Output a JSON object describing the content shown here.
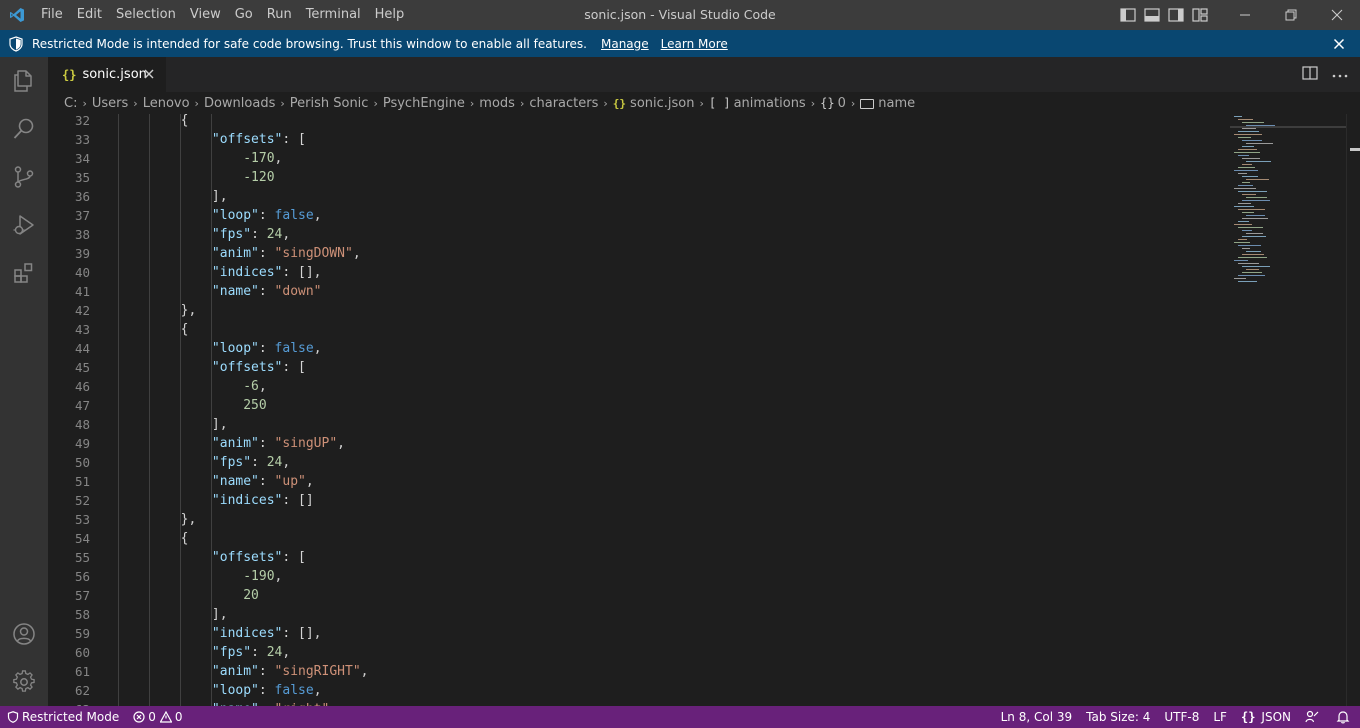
{
  "titlebar": {
    "menu": [
      "File",
      "Edit",
      "Selection",
      "View",
      "Go",
      "Run",
      "Terminal",
      "Help"
    ],
    "window_title": "sonic.json - Visual Studio Code"
  },
  "banner": {
    "text": "Restricted Mode is intended for safe code browsing. Trust this window to enable all features.",
    "manage": "Manage",
    "learn_more": "Learn More"
  },
  "tab": {
    "icon": "{}",
    "label": "sonic.json"
  },
  "breadcrumbs": {
    "path": [
      "C:",
      "Users",
      "Lenovo",
      "Downloads",
      "Perish Sonic",
      "PsychEngine",
      "mods",
      "characters"
    ],
    "file": "sonic.json",
    "file_icon": "{}",
    "symbols": [
      {
        "icon": "[ ]",
        "label": "animations"
      },
      {
        "icon": "{}",
        "label": "0"
      },
      {
        "icon": "abc",
        "label": "name"
      }
    ]
  },
  "editor": {
    "first_line": 32,
    "lines": [
      [
        [
          "pun",
          "        {"
        ]
      ],
      [
        [
          "pun",
          "            "
        ],
        [
          "key",
          "\"offsets\""
        ],
        [
          "pun",
          ": ["
        ]
      ],
      [
        [
          "pun",
          "                "
        ],
        [
          "num",
          "-170"
        ],
        [
          "pun",
          ","
        ]
      ],
      [
        [
          "pun",
          "                "
        ],
        [
          "num",
          "-120"
        ]
      ],
      [
        [
          "pun",
          "            ],"
        ]
      ],
      [
        [
          "pun",
          "            "
        ],
        [
          "key",
          "\"loop\""
        ],
        [
          "pun",
          ": "
        ],
        [
          "kw",
          "false"
        ],
        [
          "pun",
          ","
        ]
      ],
      [
        [
          "pun",
          "            "
        ],
        [
          "key",
          "\"fps\""
        ],
        [
          "pun",
          ": "
        ],
        [
          "num",
          "24"
        ],
        [
          "pun",
          ","
        ]
      ],
      [
        [
          "pun",
          "            "
        ],
        [
          "key",
          "\"anim\""
        ],
        [
          "pun",
          ": "
        ],
        [
          "str",
          "\"singDOWN\""
        ],
        [
          "pun",
          ","
        ]
      ],
      [
        [
          "pun",
          "            "
        ],
        [
          "key",
          "\"indices\""
        ],
        [
          "pun",
          ": [],"
        ]
      ],
      [
        [
          "pun",
          "            "
        ],
        [
          "key",
          "\"name\""
        ],
        [
          "pun",
          ": "
        ],
        [
          "str",
          "\"down\""
        ]
      ],
      [
        [
          "pun",
          "        },"
        ]
      ],
      [
        [
          "pun",
          "        {"
        ]
      ],
      [
        [
          "pun",
          "            "
        ],
        [
          "key",
          "\"loop\""
        ],
        [
          "pun",
          ": "
        ],
        [
          "kw",
          "false"
        ],
        [
          "pun",
          ","
        ]
      ],
      [
        [
          "pun",
          "            "
        ],
        [
          "key",
          "\"offsets\""
        ],
        [
          "pun",
          ": ["
        ]
      ],
      [
        [
          "pun",
          "                "
        ],
        [
          "num",
          "-6"
        ],
        [
          "pun",
          ","
        ]
      ],
      [
        [
          "pun",
          "                "
        ],
        [
          "num",
          "250"
        ]
      ],
      [
        [
          "pun",
          "            ],"
        ]
      ],
      [
        [
          "pun",
          "            "
        ],
        [
          "key",
          "\"anim\""
        ],
        [
          "pun",
          ": "
        ],
        [
          "str",
          "\"singUP\""
        ],
        [
          "pun",
          ","
        ]
      ],
      [
        [
          "pun",
          "            "
        ],
        [
          "key",
          "\"fps\""
        ],
        [
          "pun",
          ": "
        ],
        [
          "num",
          "24"
        ],
        [
          "pun",
          ","
        ]
      ],
      [
        [
          "pun",
          "            "
        ],
        [
          "key",
          "\"name\""
        ],
        [
          "pun",
          ": "
        ],
        [
          "str",
          "\"up\""
        ],
        [
          "pun",
          ","
        ]
      ],
      [
        [
          "pun",
          "            "
        ],
        [
          "key",
          "\"indices\""
        ],
        [
          "pun",
          ": []"
        ]
      ],
      [
        [
          "pun",
          "        },"
        ]
      ],
      [
        [
          "pun",
          "        {"
        ]
      ],
      [
        [
          "pun",
          "            "
        ],
        [
          "key",
          "\"offsets\""
        ],
        [
          "pun",
          ": ["
        ]
      ],
      [
        [
          "pun",
          "                "
        ],
        [
          "num",
          "-190"
        ],
        [
          "pun",
          ","
        ]
      ],
      [
        [
          "pun",
          "                "
        ],
        [
          "num",
          "20"
        ]
      ],
      [
        [
          "pun",
          "            ],"
        ]
      ],
      [
        [
          "pun",
          "            "
        ],
        [
          "key",
          "\"indices\""
        ],
        [
          "pun",
          ": [],"
        ]
      ],
      [
        [
          "pun",
          "            "
        ],
        [
          "key",
          "\"fps\""
        ],
        [
          "pun",
          ": "
        ],
        [
          "num",
          "24"
        ],
        [
          "pun",
          ","
        ]
      ],
      [
        [
          "pun",
          "            "
        ],
        [
          "key",
          "\"anim\""
        ],
        [
          "pun",
          ": "
        ],
        [
          "str",
          "\"singRIGHT\""
        ],
        [
          "pun",
          ","
        ]
      ],
      [
        [
          "pun",
          "            "
        ],
        [
          "key",
          "\"loop\""
        ],
        [
          "pun",
          ": "
        ],
        [
          "kw",
          "false"
        ],
        [
          "pun",
          ","
        ]
      ],
      [
        [
          "pun",
          "            "
        ],
        [
          "key",
          "\"name\""
        ],
        [
          "pun",
          ": "
        ],
        [
          "str",
          "\"right\""
        ]
      ]
    ]
  },
  "statusbar": {
    "restricted": "Restricted Mode",
    "errors": "0",
    "warnings": "0",
    "position": "Ln 8, Col 39",
    "tab_size": "Tab Size: 4",
    "encoding": "UTF-8",
    "eol": "LF",
    "language_icon": "{}",
    "language": "JSON"
  },
  "colors": {
    "statusbar": "#68217a",
    "banner": "#094771",
    "key": "#9cdcfe",
    "string": "#ce9178",
    "number": "#b5cea8",
    "keyword": "#569cd6"
  },
  "icons": {
    "activity": [
      "explorer-icon",
      "search-icon",
      "source-control-icon",
      "run-debug-icon",
      "extensions-icon",
      "account-icon",
      "settings-gear-icon"
    ]
  }
}
